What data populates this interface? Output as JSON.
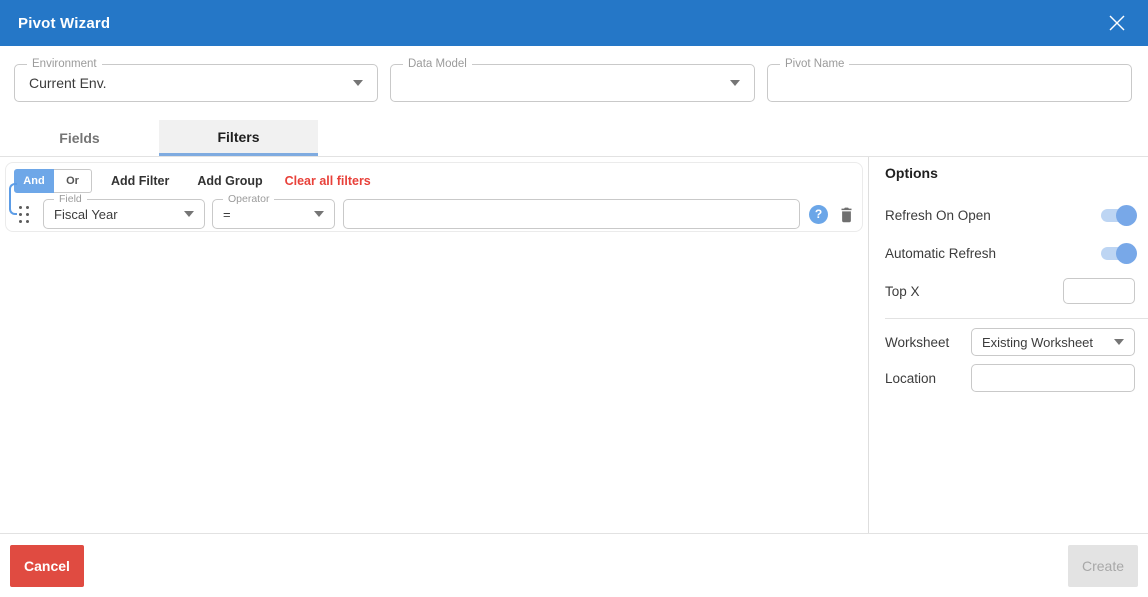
{
  "titlebar": {
    "title": "Pivot Wizard"
  },
  "form": {
    "environment": {
      "label": "Environment",
      "value": "Current Env."
    },
    "data_model": {
      "label": "Data Model",
      "value": ""
    },
    "pivot_name": {
      "label": "Pivot Name",
      "value": ""
    }
  },
  "tabs": [
    {
      "label": "Fields",
      "active": false
    },
    {
      "label": "Filters",
      "active": true
    }
  ],
  "filters": {
    "conjunction": {
      "and_label": "And",
      "or_label": "Or",
      "selected": "And"
    },
    "add_filter_label": "Add Filter",
    "add_group_label": "Add Group",
    "clear_all_label": "Clear all filters",
    "row": {
      "field": {
        "label": "Field",
        "value": "Fiscal Year"
      },
      "operator": {
        "label": "Operator",
        "value": "="
      },
      "value": {
        "value": "",
        "placeholder": ""
      },
      "help_glyph": "?"
    }
  },
  "options": {
    "heading": "Options",
    "toggles": [
      {
        "label": "Refresh On Open",
        "state": "on"
      },
      {
        "label": "Automatic Refresh",
        "state": "on"
      }
    ],
    "top_x": {
      "label": "Top X",
      "value": ""
    },
    "worksheet": {
      "label": "Worksheet",
      "value": "Existing Worksheet"
    },
    "location": {
      "label": "Location",
      "value": ""
    }
  },
  "footer": {
    "cancel_label": "Cancel",
    "create_label": "Create"
  },
  "colors": {
    "titlebar_blue": "#2577c7",
    "accent_blue": "#6ea7e8",
    "tab_underline": "#7fabe0",
    "danger_red": "#e8413a",
    "cancel_red": "#e04b41",
    "disabled_gray": "#e3e3e3"
  }
}
